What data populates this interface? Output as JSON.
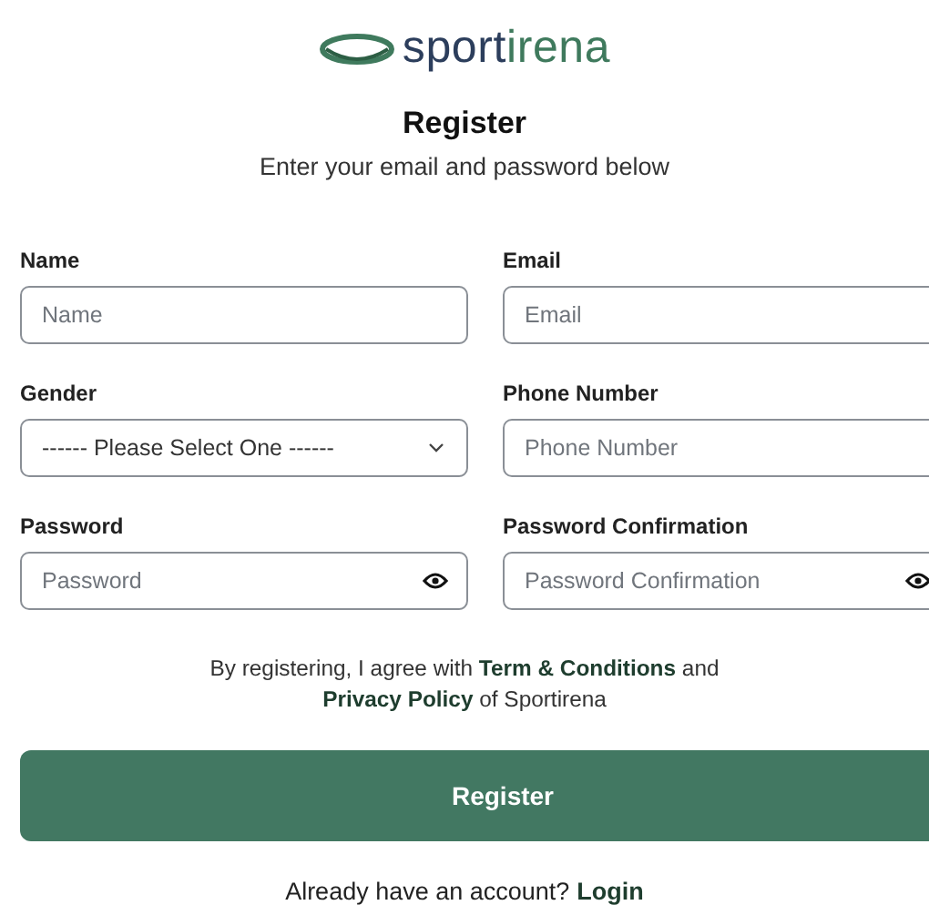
{
  "logo": {
    "parts": [
      "sport",
      "irena"
    ]
  },
  "heading": {
    "title": "Register",
    "subtitle": "Enter your email and password below"
  },
  "fields": [
    {
      "kind": "text",
      "label": "Name",
      "placeholder": "Name"
    },
    {
      "kind": "text",
      "label": "Email",
      "placeholder": "Email"
    },
    {
      "kind": "select",
      "label": "Gender",
      "value": "------ Please Select One ------"
    },
    {
      "kind": "text",
      "label": "Phone Number",
      "placeholder": "Phone Number"
    },
    {
      "kind": "password",
      "label": "Password",
      "placeholder": "Password"
    },
    {
      "kind": "password",
      "label": "Password Confirmation",
      "placeholder": "Password Confirmation"
    }
  ],
  "agreement": [
    {
      "kind": "text",
      "text": "By registering, I agree with "
    },
    {
      "kind": "link",
      "text": "Term & Conditions"
    },
    {
      "kind": "text",
      "text": " and "
    },
    {
      "kind": "break"
    },
    {
      "kind": "link",
      "text": "Privacy Policy"
    },
    {
      "kind": "text",
      "text": " of Sportirena"
    }
  ],
  "submit_button": "Register",
  "footer": {
    "text": "Already have an account?",
    "link": "Login"
  }
}
